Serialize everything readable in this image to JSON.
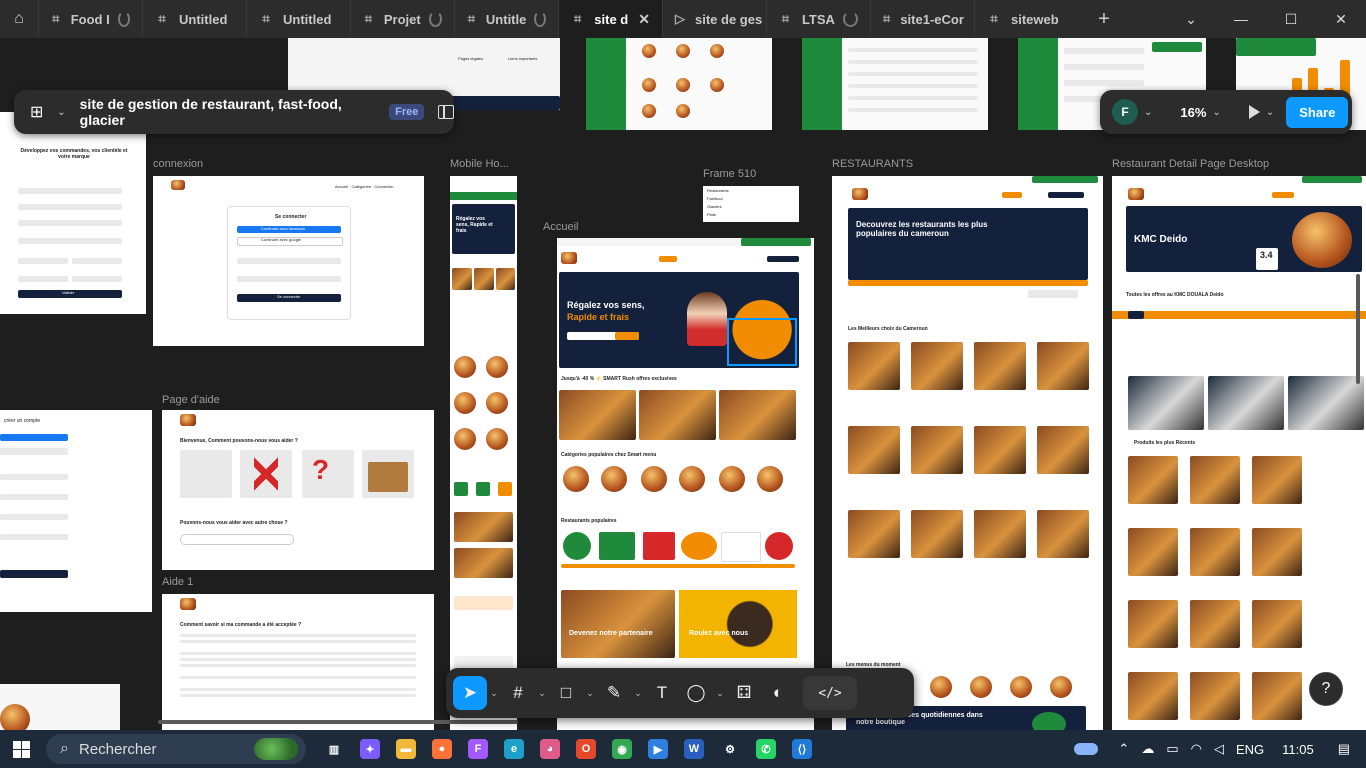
{
  "tabs": [
    {
      "label": "Food I",
      "loading": true,
      "width": 104
    },
    {
      "label": "Untitled",
      "loading": false,
      "width": 104
    },
    {
      "label": "Untitled",
      "loading": false,
      "width": 104
    },
    {
      "label": "Projet",
      "loading": true,
      "width": 104
    },
    {
      "label": "Untitle",
      "loading": true,
      "width": 104
    },
    {
      "label": "site d",
      "active": true,
      "width": 104
    },
    {
      "label": "site de ges",
      "loading": false,
      "width": 104
    },
    {
      "label": "LTSA",
      "loading": true,
      "width": 104
    },
    {
      "label": "site1-eCor",
      "loading": false,
      "width": 104
    },
    {
      "label": "siteweb",
      "loading": false,
      "width": 110
    }
  ],
  "file": {
    "name": "site de gestion de restaurant, fast-food, glacier",
    "plan_badge": "Free"
  },
  "share_panel": {
    "avatar_initial": "F",
    "zoom": "16%",
    "share_label": "Share"
  },
  "frames": {
    "connexion": "connexion",
    "mobile": "Mobile Ho...",
    "frame510": "Frame 510",
    "accueil": "Accueil",
    "restaurants": "RESTAURANTS",
    "restaurant_detail": "Restaurant Detail Page Desktop",
    "page_aide": "Page d'aide",
    "aide1": "Aide 1"
  },
  "frame_text": {
    "connexion_title": "Se connecter",
    "connexion_fb": "Continuer avec facebook",
    "connexion_google": "Continuer avec google",
    "connexion_btn": "Se connecter",
    "signup_title": "Développez vos commandes, vos clientèle et votre marque",
    "signup_btn": "Valider",
    "hero_title_1": "Régalez vos sens,",
    "hero_title_2": "Rapide et frais",
    "offers": "Jusqu'à -40 % ⚡ SMART Rush offres exclusives",
    "categories": "Catégories populaires chez Smart menu",
    "popular_restaurants": "Restaurants populaires",
    "partner": "Devenez notre partenaire",
    "ride": "Roulez avec nous",
    "restaurants_hero": "Decouvrez les restaurants les plus populaires du cameroun",
    "restaurants_best": "Les Meilleurs choix du Cameroun",
    "restaurants_menus": "Les menus du moment",
    "restaurants_courses": "Faites vos courses quotidiennes dans notre boutique",
    "detail_name": "KMC Deido",
    "detail_rating": "3.4",
    "detail_offers": "Toutes les offres au KMC DOUALA Deido",
    "detail_recent": "Produits les plus Récents",
    "help_title": "Bienvenue, Comment pouvons-nous vous aider ?",
    "help_other": "Pouvons-nous vous aider avec autre chose ?",
    "aide_title": "Comment savoir si ma commande a été acceptée ?",
    "mobile_title": "Régalez vos sens, Rapide et frais",
    "frame510_items": [
      "Restaurants",
      "Fastfood",
      "Glaciers",
      "Plats"
    ]
  },
  "toolbar": {
    "tools": [
      "move-tool",
      "frame-tool",
      "shape-tool",
      "pen-tool",
      "text-tool",
      "comment-tool",
      "actions-tool",
      "plugin-tool"
    ],
    "dev_mode": "</>"
  },
  "taskbar": {
    "search_placeholder": "Rechercher",
    "language": "ENG",
    "time": "11:05",
    "apps": [
      {
        "name": "task-view",
        "color": "#1c2a3a",
        "glyph": "▥"
      },
      {
        "name": "copilot",
        "color": "#7b5cff",
        "glyph": "✦"
      },
      {
        "name": "file-explorer",
        "color": "#f2b83a",
        "glyph": "▬"
      },
      {
        "name": "firefox",
        "color": "#ff7139",
        "glyph": "●"
      },
      {
        "name": "figma",
        "color": "#a259ff",
        "glyph": "F"
      },
      {
        "name": "edge",
        "color": "#1ea0c8",
        "glyph": "e"
      },
      {
        "name": "paint",
        "color": "#e05a8a",
        "glyph": "◕"
      },
      {
        "name": "office",
        "color": "#e5482a",
        "glyph": "O"
      },
      {
        "name": "chrome",
        "color": "#34a853",
        "glyph": "◉"
      },
      {
        "name": "media-player",
        "color": "#2f7fe0",
        "glyph": "▶"
      },
      {
        "name": "word",
        "color": "#2b5fbf",
        "glyph": "W"
      },
      {
        "name": "settings",
        "color": "#1c2a3a",
        "glyph": "⚙"
      },
      {
        "name": "whatsapp",
        "color": "#25d366",
        "glyph": "✆"
      },
      {
        "name": "vscode",
        "color": "#1f7ad8",
        "glyph": "⟨⟩"
      }
    ]
  },
  "colors": {
    "accent": "#0d99ff",
    "green": "#1f8a3c",
    "orange": "#f28c00",
    "navy": "#14213d"
  }
}
